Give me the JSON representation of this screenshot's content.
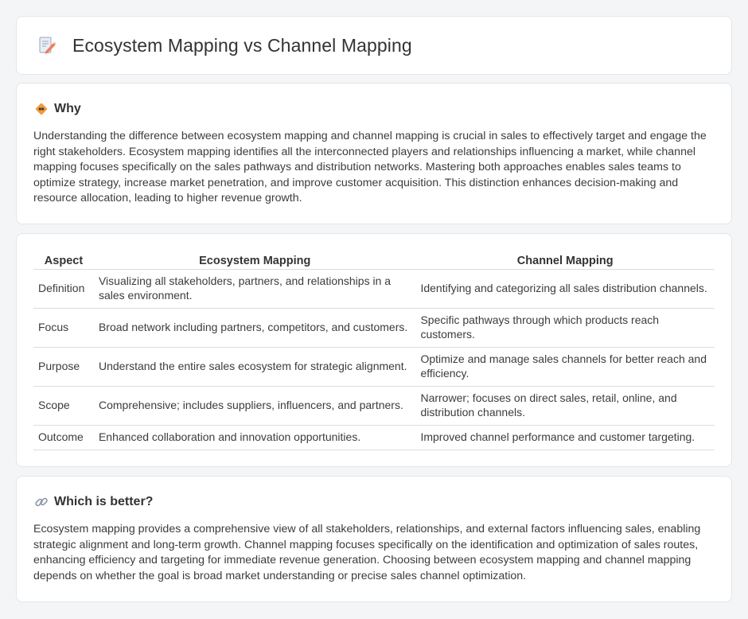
{
  "header": {
    "title": "Ecosystem Mapping vs Channel Mapping",
    "icon": "document-pencil-icon"
  },
  "why": {
    "heading": "Why",
    "icon": "diamond-sign-icon",
    "text": "Understanding the difference between ecosystem mapping and channel mapping is crucial in sales to effectively target and engage the right stakeholders. Ecosystem mapping identifies all the interconnected players and relationships influencing a market, while channel mapping focuses specifically on the sales pathways and distribution networks. Mastering both approaches enables sales teams to optimize strategy, increase market penetration, and improve customer acquisition. This distinction enhances decision-making and resource allocation, leading to higher revenue growth."
  },
  "table": {
    "headers": [
      "Aspect",
      "Ecosystem Mapping",
      "Channel Mapping"
    ],
    "rows": [
      {
        "aspect": "Definition",
        "ecosystem": "Visualizing all stakeholders, partners, and relationships in a sales environment.",
        "channel": "Identifying and categorizing all sales distribution channels."
      },
      {
        "aspect": "Focus",
        "ecosystem": "Broad network including partners, competitors, and customers.",
        "channel": "Specific pathways through which products reach customers."
      },
      {
        "aspect": "Purpose",
        "ecosystem": "Understand the entire sales ecosystem for strategic alignment.",
        "channel": "Optimize and manage sales channels for better reach and efficiency."
      },
      {
        "aspect": "Scope",
        "ecosystem": "Comprehensive; includes suppliers, influencers, and partners.",
        "channel": "Narrower; focuses on direct sales, retail, online, and distribution channels."
      },
      {
        "aspect": "Outcome",
        "ecosystem": "Enhanced collaboration and innovation opportunities.",
        "channel": "Improved channel performance and customer targeting."
      }
    ]
  },
  "better": {
    "heading": "Which is better?",
    "icon": "link-icon",
    "text": "Ecosystem mapping provides a comprehensive view of all stakeholders, relationships, and external factors influencing sales, enabling strategic alignment and long-term growth. Channel mapping focuses specifically on the identification and optimization of sales routes, enhancing efficiency and targeting for immediate revenue generation. Choosing between ecosystem mapping and channel mapping depends on whether the goal is broad market understanding or precise sales channel optimization."
  },
  "colors": {
    "background": "#f4f5f7",
    "card": "#ffffff",
    "text": "#3c3c3c",
    "icon_accent": "#f29a3a"
  }
}
